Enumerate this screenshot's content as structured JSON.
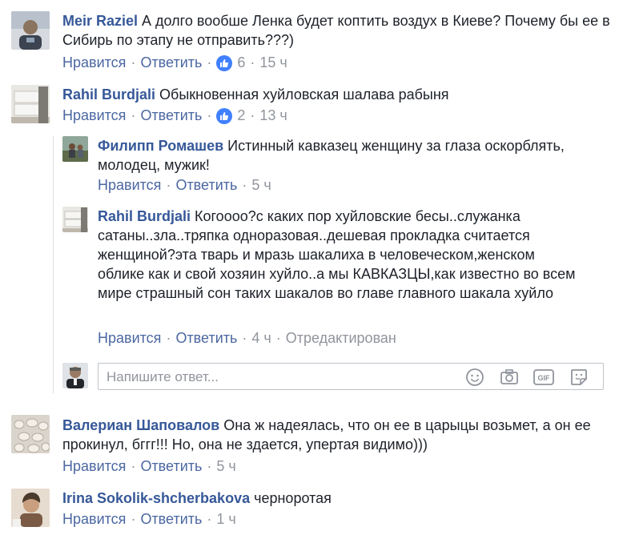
{
  "comments": [
    {
      "author": "Meir Raziel",
      "text": "А долго вообше Ленка будет коптить воздух в Киеве? Почему бы ее в Сибирь по этапу не отправить???)",
      "like_label": "Нравится",
      "reply_label": "Ответить",
      "reactions": "6",
      "time": "15 ч"
    },
    {
      "author": "Rahil Burdjali",
      "text": "Обыкновенная хуйловская шалава рабыня",
      "like_label": "Нравится",
      "reply_label": "Ответить",
      "reactions": "2",
      "time": "13 ч"
    },
    {
      "author": "Валериан Шаповалов",
      "text": "Она ж надеялась, что он ее в царыцы возьмет, а он ее прокинул, бггг!!! Но, она не здается, упертая видимо)))",
      "like_label": "Нравится",
      "reply_label": "Ответить",
      "time": "5 ч"
    },
    {
      "author": "Irina Sokolik-shcherbakova",
      "text": "черноротая",
      "like_label": "Нравится",
      "reply_label": "Ответить",
      "time": "1 ч"
    }
  ],
  "replies": [
    {
      "author": "Филипп Ромашев",
      "text": "Истинный кавказец женщину за глаза оскорблять, молодец, мужик!",
      "like_label": "Нравится",
      "reply_label": "Ответить",
      "time": "5 ч"
    },
    {
      "author": "Rahil Burdjali",
      "text": "Когоооо?с каких пор хуйловские бесы..служанка сатаны..зла..тряпка одноразовая..дешевая прокладка считается женщиной?эта тварь и мразь шакалиха в человеческом,женском облике как и свой хозяин хуйло..а мы КАВКАЗЦЫ,как известно во всем мире страшный сон таких шакалов во главе главного шакала хуйло",
      "like_label": "Нравится",
      "reply_label": "Ответить",
      "time": "4 ч",
      "edited": "Отредактирован"
    }
  ],
  "reply_input": {
    "placeholder": "Напишите ответ..."
  },
  "icons": [
    "smiley-icon",
    "camera-icon",
    "gif-icon",
    "sticker-icon",
    "thumbs-up-icon"
  ],
  "colors": {
    "author": "#365899",
    "link": "#4b67a1",
    "meta": "#90949c",
    "like_badge": "#4080ff"
  }
}
